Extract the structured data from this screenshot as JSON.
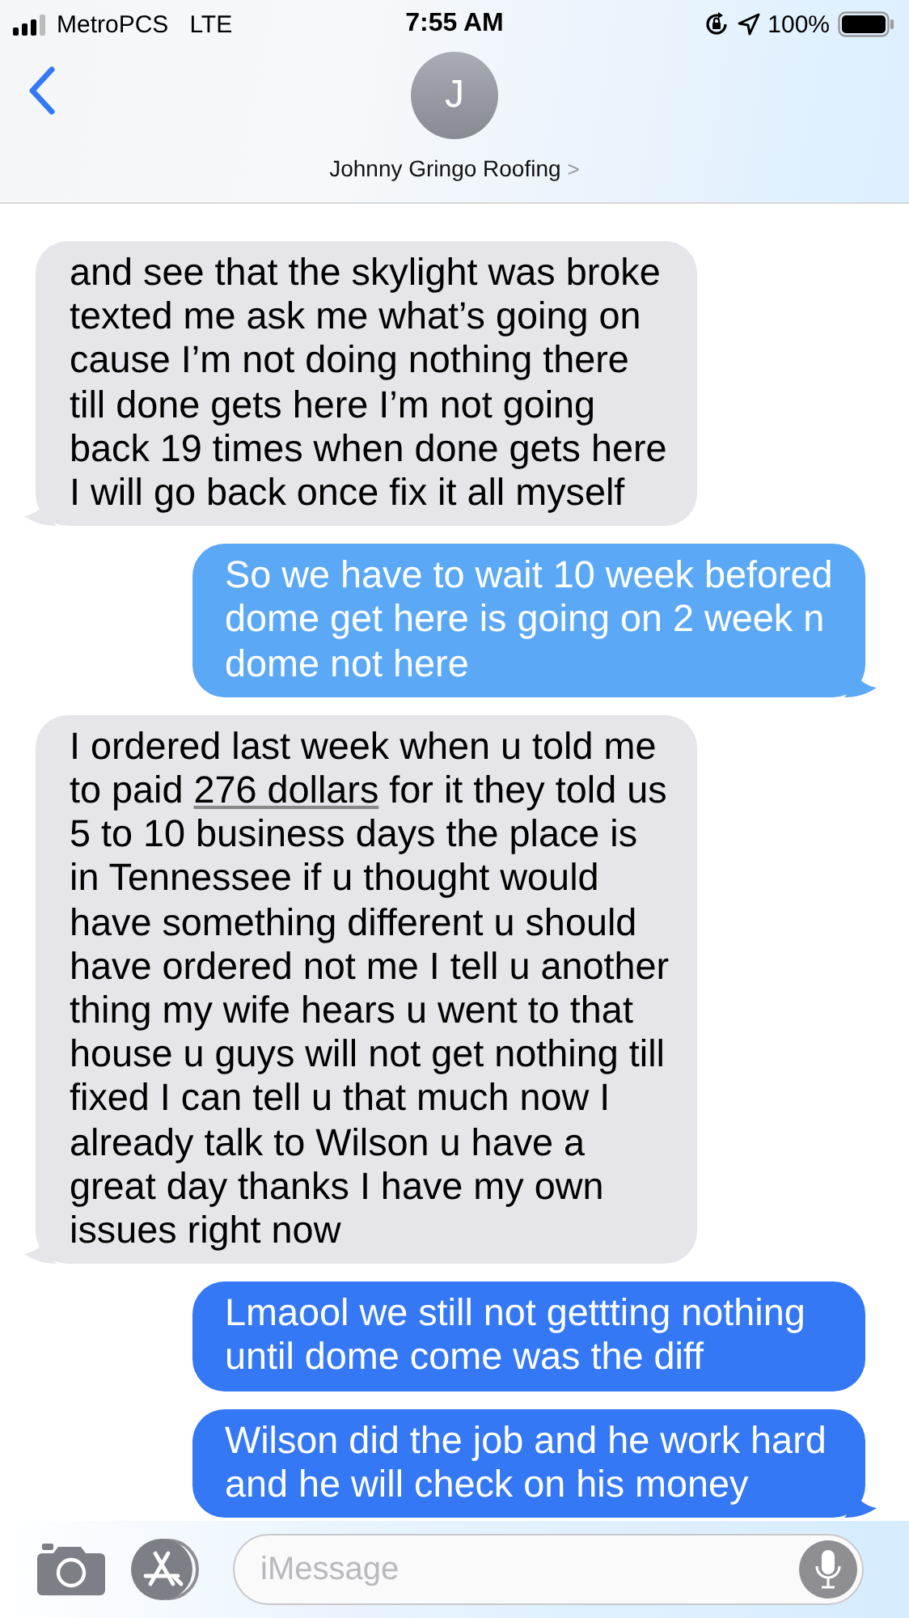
{
  "status_bar": {
    "carrier": "MetroPCS",
    "network": "LTE",
    "time": "7:55 AM",
    "battery": "100%"
  },
  "header": {
    "avatar_initial": "J",
    "contact_name": "Johnny Gringo Roofing",
    "chevron": ">"
  },
  "messages": [
    {
      "kind": "incoming",
      "tail": true,
      "parts": [
        {
          "kind": "text",
          "text": "and see that the skylight was broke texted me ask me what’s going on cause I’m not doing nothing there till done gets here I’m not going back 19 times when done gets here I will go back once fix it all myself"
        }
      ]
    },
    {
      "kind": "outgoing",
      "tail": true,
      "color": "#5ba9f6",
      "parts": [
        {
          "kind": "text",
          "text": "So we have to wait 10 week befored dome get here is going on 2 week n dome not here"
        }
      ]
    },
    {
      "kind": "incoming",
      "tail": true,
      "parts": [
        {
          "kind": "text",
          "text": "I ordered last week when u told me to paid "
        },
        {
          "kind": "link",
          "text": "276 dollars"
        },
        {
          "kind": "text",
          "text": " for it they told us 5 to 10 business days the place is in Tennessee if u thought would have something different u should have ordered not me I tell u another thing my wife hears u went to that house u guys will not get nothing till fixed I can tell u that much now I already talk to Wilson u have a great day thanks I have my own issues right now"
        }
      ]
    },
    {
      "kind": "outgoing",
      "tail": false,
      "color": "#3478f6",
      "parts": [
        {
          "kind": "text",
          "text": "Lmaool we still not gettting nothing until dome come was the diff"
        }
      ]
    },
    {
      "kind": "outgoing",
      "tail": true,
      "color": "#3478f6",
      "parts": [
        {
          "kind": "text",
          "text": "Wilson did the job and he work hard and he will check on his money"
        }
      ]
    }
  ],
  "composer": {
    "placeholder": "iMessage"
  }
}
